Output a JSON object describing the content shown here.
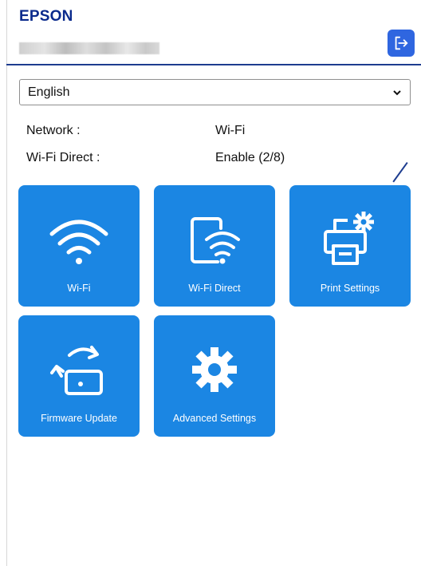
{
  "header": {
    "brand": "EPSON",
    "logout_icon": "logout-icon"
  },
  "language": {
    "selected": "English"
  },
  "status": [
    {
      "label": "Network :",
      "value": "Wi-Fi"
    },
    {
      "label": "Wi-Fi Direct :",
      "value": "Enable (2/8)"
    }
  ],
  "tiles": [
    {
      "label": "Wi-Fi",
      "icon": "wifi-icon"
    },
    {
      "label": "Wi-Fi Direct",
      "icon": "wifi-direct-icon"
    },
    {
      "label": "Print Settings",
      "icon": "print-settings-icon"
    },
    {
      "label": "Firmware Update",
      "icon": "firmware-update-icon"
    },
    {
      "label": "Advanced Settings",
      "icon": "gear-icon"
    }
  ],
  "colors": {
    "accent": "#1b86e3",
    "brand": "#0a2a8c",
    "logout": "#2f66e0"
  }
}
